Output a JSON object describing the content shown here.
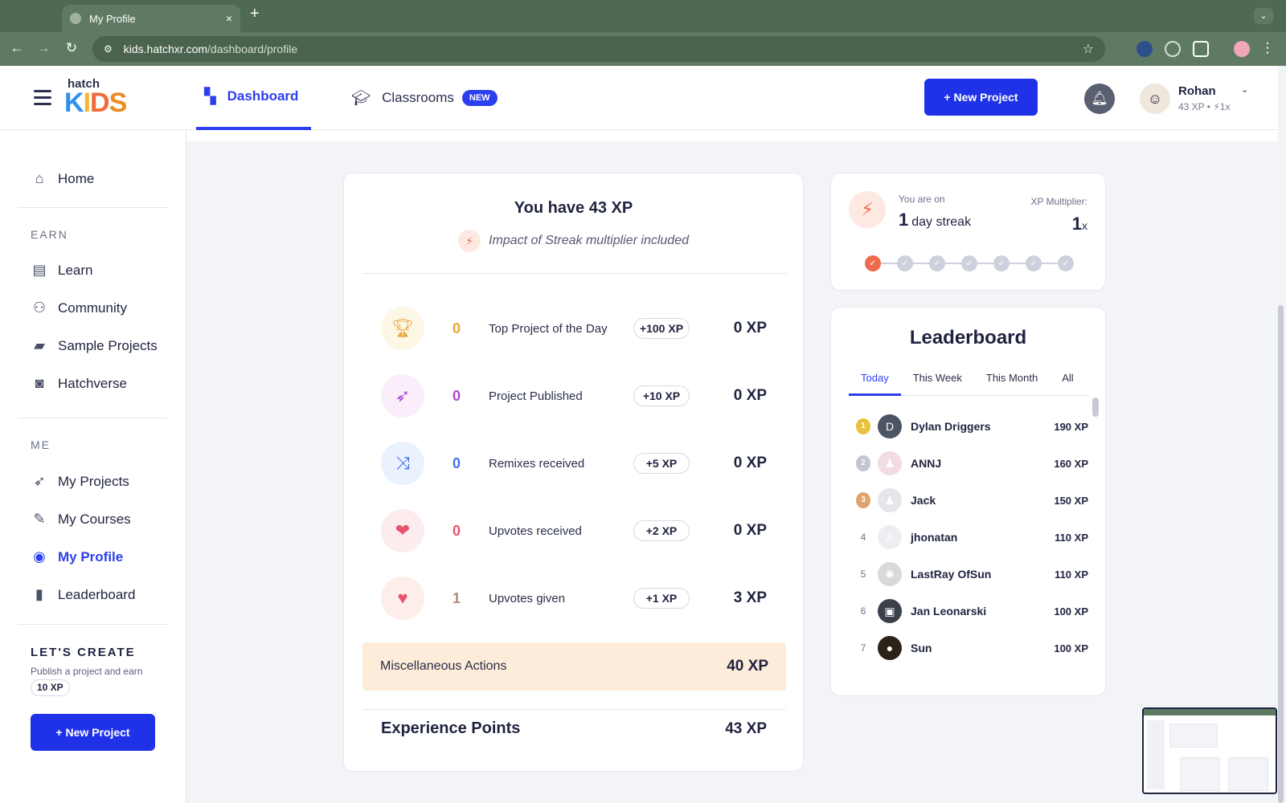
{
  "browser": {
    "tab_title": "My Profile",
    "tab_close": "×",
    "new_tab": "+",
    "tab_dropdown": "⌄",
    "url_host": "kids.hatchxr.com",
    "url_path": "/dashboard/profile",
    "back": "←",
    "forward": "→",
    "reload": "↻",
    "tune": "⚙",
    "star": "☆"
  },
  "header": {
    "logo_top": "hatch",
    "logo_letters": [
      "K",
      "I",
      "D",
      "S"
    ],
    "tabs": [
      {
        "label": "Dashboard",
        "icon": "dashboard-icon"
      },
      {
        "label": "Classrooms",
        "icon": "graduation-cap-icon",
        "badge": "NEW"
      }
    ],
    "new_project": "+ New Project",
    "user": {
      "name": "Rohan",
      "meta": "43 XP • ⚡1x",
      "caret": "⌄"
    }
  },
  "sidebar": {
    "home": "Home",
    "earn_heading": "EARN",
    "earn_items": [
      "Learn",
      "Community",
      "Sample Projects",
      "Hatchverse"
    ],
    "me_heading": "ME",
    "me_items": [
      "My Projects",
      "My Courses",
      "My Profile",
      "Leaderboard"
    ],
    "create_title": "LET'S CREATE",
    "create_desc_text": "Publish a project and earn",
    "create_desc_xp": "10 XP",
    "new_project": "+ New Project"
  },
  "xp_summary": {
    "title": "You have 43 XP",
    "subtitle": "Impact of Streak multiplier included",
    "rows": [
      {
        "count": "0",
        "label": "Top Project of the Day",
        "rate": "+100 XP",
        "value": "0 XP",
        "icon": "trophy-icon",
        "count_color": "#e8a23a",
        "bg": "#fdf7e6"
      },
      {
        "count": "0",
        "label": "Project Published",
        "rate": "+10 XP",
        "value": "0 XP",
        "icon": "rocket-icon",
        "count_color": "#b044d6",
        "bg": "#fbeefb"
      },
      {
        "count": "0",
        "label": "Remixes received",
        "rate": "+5 XP",
        "value": "0 XP",
        "icon": "shuffle-icon",
        "count_color": "#3f6ef0",
        "bg": "#eaf2fd"
      },
      {
        "count": "0",
        "label": "Upvotes received",
        "rate": "+2 XP",
        "value": "0 XP",
        "icon": "hearts-icon",
        "count_color": "#e8526a",
        "bg": "#fdecee"
      },
      {
        "count": "1",
        "label": "Upvotes given",
        "rate": "+1 XP",
        "value": "3 XP",
        "icon": "heart-hand-icon",
        "count_color": "#b08a7a",
        "bg": "#fdeee9"
      }
    ],
    "misc_label": "Miscellaneous Actions",
    "misc_value": "40 XP",
    "total_label": "Experience Points",
    "total_value": "43 XP"
  },
  "streak": {
    "on_label": "You are on",
    "days": "1",
    "days_suffix": "day streak",
    "multiplier_label": "XP Multiplier:",
    "multiplier": "1",
    "multiplier_suffix": "x",
    "completed_days": 1,
    "total_days": 7
  },
  "leaderboard": {
    "title": "Leaderboard",
    "tabs": [
      "Today",
      "This Week",
      "This Month",
      "All"
    ],
    "active_tab": "Today",
    "rows": [
      {
        "rank": "1",
        "name": "Dylan Driggers",
        "xp": "190 XP",
        "avatar": "D",
        "avatar_bg": "#4b5563"
      },
      {
        "rank": "2",
        "name": "ANNJ",
        "xp": "160 XP",
        "avatar": "♟",
        "avatar_bg": "#f3dbe6"
      },
      {
        "rank": "3",
        "name": "Jack",
        "xp": "150 XP",
        "avatar": "♟",
        "avatar_bg": "#e4e6ea"
      },
      {
        "rank": "4",
        "name": "jhonatan",
        "xp": "110 XP",
        "avatar": "♙",
        "avatar_bg": "#eceef2"
      },
      {
        "rank": "5",
        "name": "LastRay OfSun",
        "xp": "110 XP",
        "avatar": "✺",
        "avatar_bg": "#d9d9d9"
      },
      {
        "rank": "6",
        "name": "Jan Leonarski",
        "xp": "100 XP",
        "avatar": "▣",
        "avatar_bg": "#3a3f4a"
      },
      {
        "rank": "7",
        "name": "Sun",
        "xp": "100 XP",
        "avatar": "●",
        "avatar_bg": "#2a2418"
      }
    ]
  },
  "colors": {
    "accent": "#2c3ff0",
    "primary_button": "#1f32e8",
    "streak": "#ef6b4c",
    "misc_bg": "#fdecd9",
    "chrome": "#5f7a62"
  }
}
